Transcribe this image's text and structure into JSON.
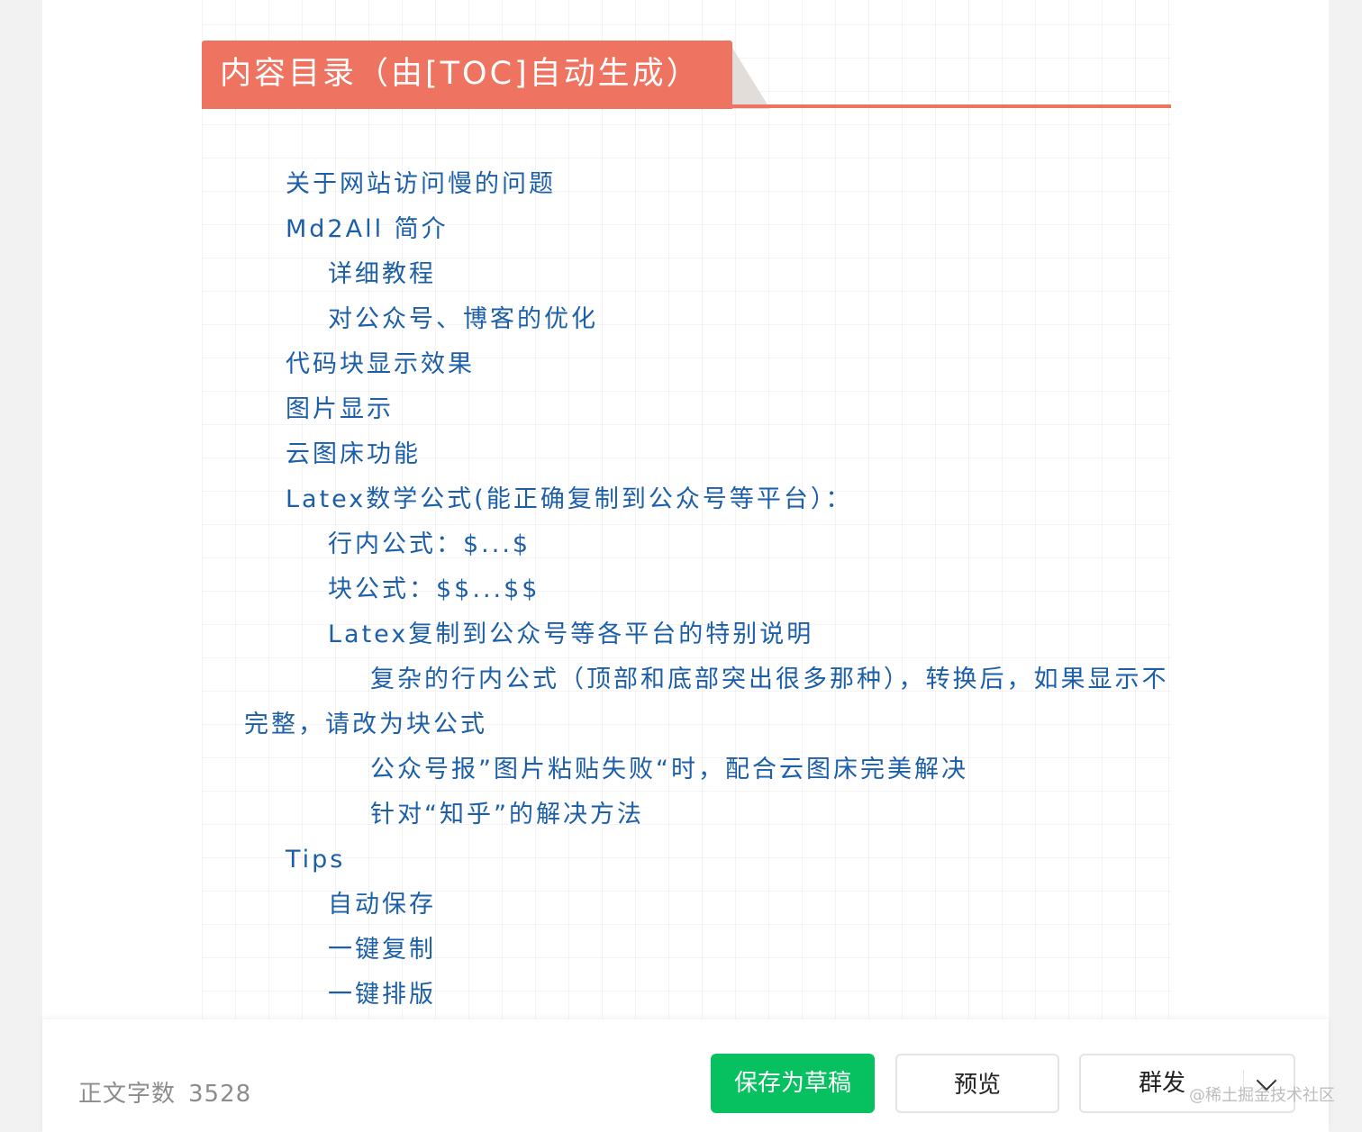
{
  "toc": {
    "title": "内容目录（由[TOC]自动生成）",
    "items": [
      {
        "text": "关于网站访问慢的问题",
        "level": 1
      },
      {
        "text": "Md2All 简介",
        "level": 1
      },
      {
        "text": "详细教程",
        "level": 2
      },
      {
        "text": "对公众号、博客的优化",
        "level": 2
      },
      {
        "text": "代码块显示效果",
        "level": 1
      },
      {
        "text": "图片显示",
        "level": 1
      },
      {
        "text": "云图床功能",
        "level": 1
      },
      {
        "text": "Latex数学公式(能正确复制到公众号等平台）：",
        "level": 1
      },
      {
        "text": "行内公式：$...$",
        "level": 2
      },
      {
        "text": "块公式：$$...$$",
        "level": 2
      },
      {
        "text": "Latex复制到公众号等各平台的特别说明",
        "level": 2
      },
      {
        "text": "复杂的行内公式（顶部和底部突出很多那种），转换后，如果显示不完整，请改为块公式",
        "level": 3
      },
      {
        "text": "公众号报”图片粘贴失败“时，配合云图床完美解决",
        "level": 3
      },
      {
        "text": "针对“知乎”的解决方法",
        "level": 3
      },
      {
        "text": "Tips",
        "level": 1
      },
      {
        "text": "自动保存",
        "level": 2
      },
      {
        "text": "一键复制",
        "level": 2
      },
      {
        "text": "一键排版",
        "level": 2
      }
    ]
  },
  "footer": {
    "word_count_label": "正文字数",
    "word_count_value": "3528",
    "save_draft_label": "保存为草稿",
    "preview_label": "预览",
    "mass_send_label": "群发",
    "watermark": "@稀土掘金技术社区"
  },
  "colors": {
    "toc_accent": "#ee7461",
    "toc_link": "#1c5fa8",
    "save_button": "#07c160"
  }
}
